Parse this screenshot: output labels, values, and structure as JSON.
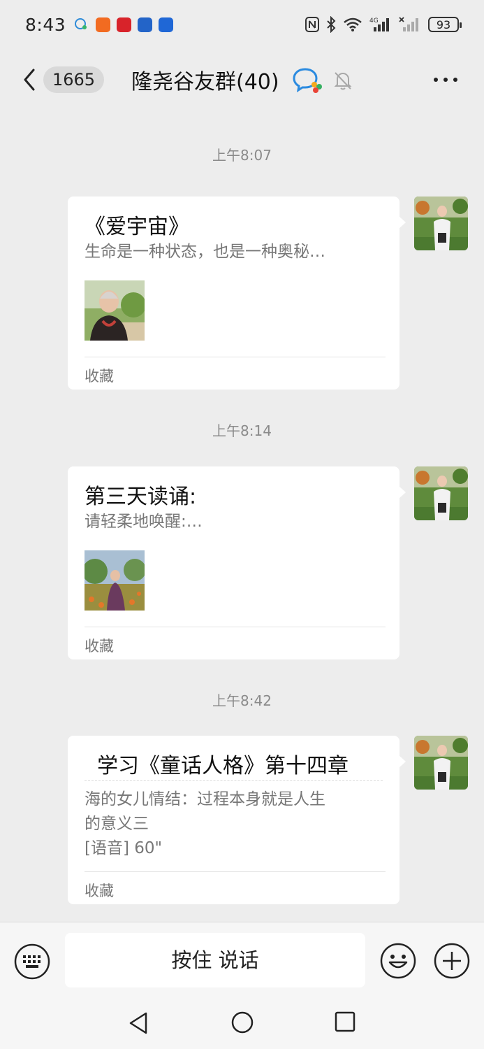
{
  "status_bar": {
    "time": "8:43",
    "battery": "93",
    "network": "4G"
  },
  "header": {
    "unread_count": "1665",
    "title": "隆尧谷友群(40)"
  },
  "messages": [
    {
      "timestamp": "上午8:07",
      "title": "《爱宇宙》",
      "description": "生命是一种状态，也是一种奥秘…",
      "source": "收藏"
    },
    {
      "timestamp": "上午8:14",
      "title": "第三天读诵:",
      "description": "请轻柔地唤醒:…",
      "source": "收藏"
    },
    {
      "timestamp": "上午8:42",
      "title": "学习《童话人格》第十四章",
      "description_line1": "海的女儿情结：过程本身就是人生",
      "description_line2": "的意义三",
      "description_line3": "[语音] 60\"",
      "source": "收藏"
    }
  ],
  "input_bar": {
    "hold_to_talk": "按住 说话"
  }
}
